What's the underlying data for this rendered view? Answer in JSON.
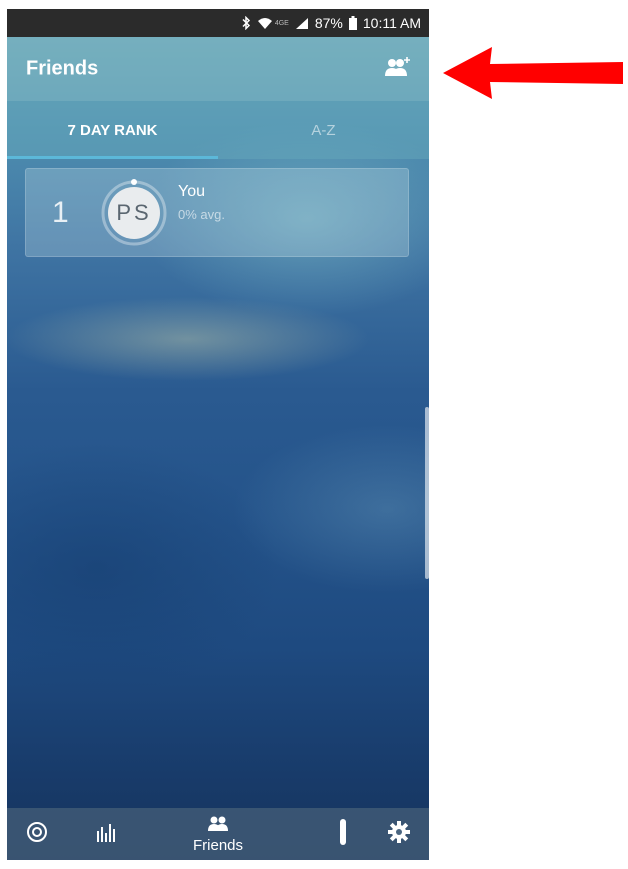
{
  "status_bar": {
    "network_label": "4GE",
    "battery": "87%",
    "time": "10:11 AM"
  },
  "header": {
    "title": "Friends",
    "add_friend_icon": "add-friend-icon"
  },
  "tabs": [
    {
      "label": "7 DAY RANK",
      "active": true
    },
    {
      "label": "A-Z",
      "active": false
    }
  ],
  "leaderboard": [
    {
      "rank": "1",
      "initials": "PS",
      "name": "You",
      "avg": "0% avg."
    }
  ],
  "bottom_nav": {
    "items": [
      {
        "icon": "activity-ring-icon"
      },
      {
        "icon": "bar-chart-icon"
      },
      {
        "icon": "friends-icon",
        "label": "Friends",
        "active": true
      },
      {
        "icon": "device-icon"
      },
      {
        "icon": "gear-icon"
      }
    ]
  },
  "colors": {
    "accent": "#5cb8d9",
    "annotation_arrow": "#ff0000",
    "status_bar": "#2b2b2b"
  }
}
